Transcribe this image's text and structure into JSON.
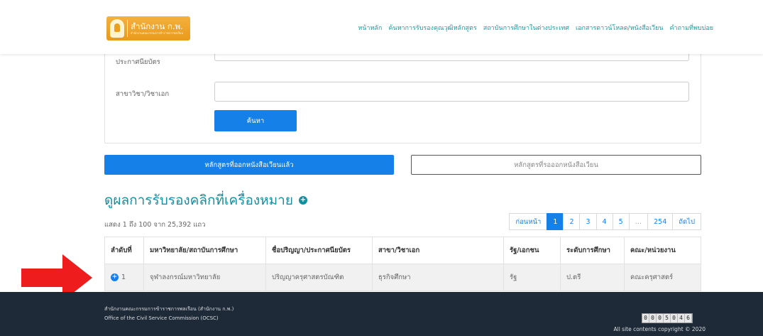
{
  "header": {
    "logo_text": "สำนักงาน ก.พ.",
    "logo_sub": "สำนักงานคณะกรรมการข้าราชการพลเรือน",
    "nav": [
      "หน้าหลัก",
      "ค้นหาการรับรองคุณวุฒิหลักสูตร",
      "สถาบันการศึกษาในต่างประเทศ",
      "เอกสารดาวน์โหลด/หนังสือเวียน",
      "คำถามที่พบบ่อย"
    ]
  },
  "search": {
    "degree_label": "ประกาศนียบัตร",
    "major_label": "สาขาวิชา/วิชาเอก",
    "major_value": "",
    "search_button": "ค้นหา"
  },
  "tabs": {
    "issued": "หลักสูตรที่ออกหนังสือเวียนแล้ว",
    "pending": "หลักสูตรที่รอออกหนังสือเวียน"
  },
  "results": {
    "heading": "ดูผลการรับรองคลิกที่เครื่องหมาย",
    "showing": "แสดง 1 ถึง 100 จาก 25,392 แถว"
  },
  "pagination": [
    "ก่อนหน้า",
    "1",
    "2",
    "3",
    "4",
    "5",
    "…",
    "254",
    "ถัดไป"
  ],
  "pagination_active": "1",
  "table": {
    "columns": [
      "ลำดับที่",
      "มหาวิทยาลัย/สถาบันการศึกษา",
      "ชื่อปริญญา/ประกาศนียบัตร",
      "สาขา/วิชาเอก",
      "รัฐ/เอกชน",
      "ระดับการศึกษา",
      "คณะ/หน่วยงาน"
    ],
    "rows": [
      [
        "1",
        "จุฬาลงกรณ์มหาวิทยาลัย",
        "ปริญญาครุศาสตรบัณฑิต",
        "ธุรกิจศึกษา",
        "รัฐ",
        "ป.ตรี",
        "คณะครุศาสตร์"
      ]
    ]
  },
  "footer": {
    "line1": "สำนักงานคณะกรรมการข้าราชการพลเรือน (สำนักงาน ก.พ.)",
    "line2": "Office of the Civil Service Commission (OCSC)",
    "counter": "0005046",
    "copyright": "All site contents copyright © 2020"
  },
  "colors": {
    "primary": "#1580e8",
    "teal": "#158fa0",
    "footer_bg": "#1f2a38",
    "arrow": "#ee1c1c",
    "logo": "#f0a52a"
  }
}
